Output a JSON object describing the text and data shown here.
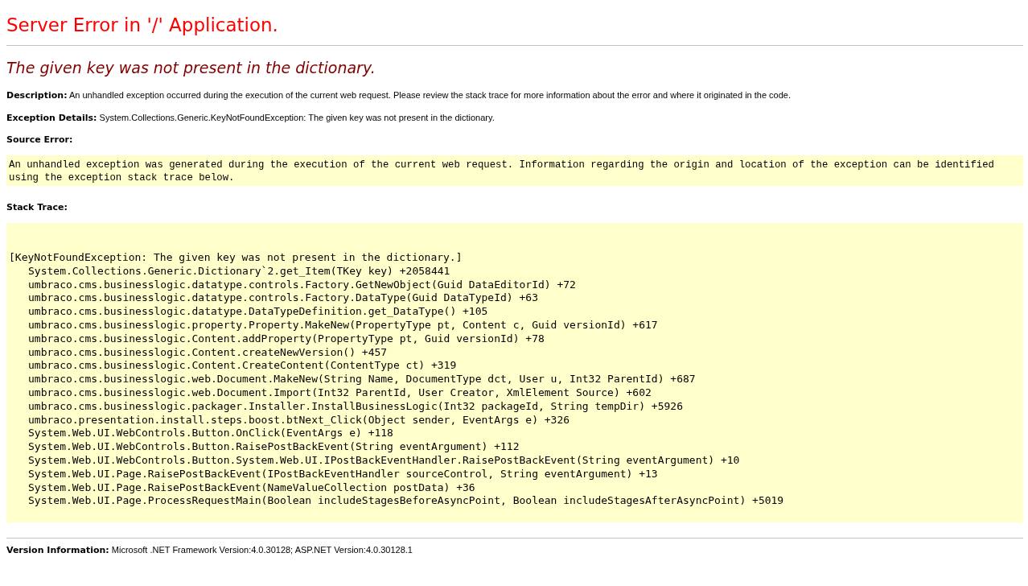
{
  "title": "Server Error in '/' Application.",
  "message": "The given key was not present in the dictionary.",
  "description": "**Description:** An unhandled exception occurred during the execution of the current web request. Please review the stack trace for more information about the error and where it originated in the code.",
  "exception_details": "**Exception Details:** System.Collections.Generic.KeyNotFoundException: The given key was not present in the dictionary.",
  "source_error": {
    "heading": "Source Error:",
    "text": "An unhandled exception was generated during the execution of the current web request. Information regarding the origin and location of the exception can be identified using the exception stack trace below."
  },
  "stack_trace": {
    "heading": "Stack Trace:",
    "exception": "[KeyNotFoundException: The given key was not present in the dictionary.]",
    "frames": [
      "System.Collections.Generic.Dictionary`2.get_Item(TKey key) +2058441",
      "umbraco.cms.businesslogic.datatype.controls.Factory.GetNewObject(Guid DataEditorId) +72",
      "umbraco.cms.businesslogic.datatype.controls.Factory.DataType(Guid DataTypeId) +63",
      "umbraco.cms.businesslogic.datatype.DataTypeDefinition.get_DataType() +105",
      "umbraco.cms.businesslogic.property.Property.MakeNew(PropertyType pt, Content c, Guid versionId) +617",
      "umbraco.cms.businesslogic.Content.addProperty(PropertyType pt, Guid versionId) +78",
      "umbraco.cms.businesslogic.Content.createNewVersion() +457",
      "umbraco.cms.businesslogic.Content.CreateContent(ContentType ct) +319",
      "umbraco.cms.businesslogic.web.Document.MakeNew(String Name, DocumentType dct, User u, Int32 ParentId) +687",
      "umbraco.cms.businesslogic.web.Document.Import(Int32 ParentId, User Creator, XmlElement Source) +602",
      "umbraco.cms.businesslogic.packager.Installer.InstallBusinessLogic(Int32 packageId, String tempDir) +5926",
      "umbraco.presentation.install.steps.boost.btNext_Click(Object sender, EventArgs e) +326",
      "System.Web.UI.WebControls.Button.OnClick(EventArgs e) +118",
      "System.Web.UI.WebControls.Button.RaisePostBackEvent(String eventArgument) +112",
      "System.Web.UI.WebControls.Button.System.Web.UI.IPostBackEventHandler.RaisePostBackEvent(String eventArgument) +10",
      "System.Web.UI.Page.RaisePostBackEvent(IPostBackEventHandler sourceControl, String eventArgument) +13",
      "System.Web.UI.Page.RaisePostBackEvent(NameValueCollection postData) +36",
      "System.Web.UI.Page.ProcessRequestMain(Boolean includeStagesBeforeAsyncPoint, Boolean includeStagesAfterAsyncPoint) +5019"
    ]
  },
  "version_information": "**Version Information:** Microsoft .NET Framework Version:4.0.30128; ASP.NET Version:4.0.30128.1"
}
